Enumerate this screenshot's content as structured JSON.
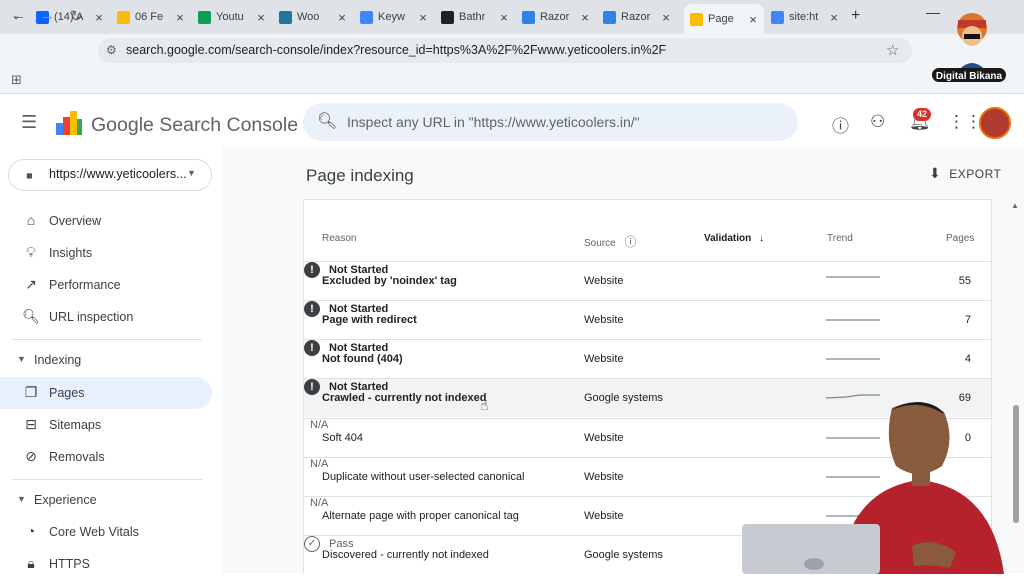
{
  "browser": {
    "tabs": [
      {
        "label": "(14) A",
        "icon": "meta-icon",
        "color": "#0866ff"
      },
      {
        "label": "06 Fe",
        "icon": "google-drive-icon",
        "color": "#fbbc04"
      },
      {
        "label": "Youtu",
        "icon": "google-sheets-icon",
        "color": "#0f9d58"
      },
      {
        "label": "Woo",
        "icon": "wordpress-icon",
        "color": "#21759b"
      },
      {
        "label": "Keyw",
        "icon": "semrush-icon",
        "color": "#4285f4"
      },
      {
        "label": "Bathr",
        "icon": "openai-icon",
        "color": "#202124"
      },
      {
        "label": "Razor",
        "icon": "razorpay-icon",
        "color": "#2b84ea"
      },
      {
        "label": "Razor",
        "icon": "razorpay-icon",
        "color": "#2b84ea"
      },
      {
        "label": "Page",
        "icon": "search-console-icon",
        "color": "#fbbc04",
        "active": true
      },
      {
        "label": "site:ht",
        "icon": "google-icon",
        "color": "#4285f4"
      }
    ],
    "url": "search.google.com/search-console/index?resource_id=https%3A%2F%2Fwww.yeticoolers.in%2F"
  },
  "watermark": {
    "text": "Digital Bikana"
  },
  "header": {
    "product": "Google Search Console",
    "search_placeholder": "Inspect any URL in \"https://www.yeticoolers.in/\"",
    "notification_count": "42"
  },
  "sidebar": {
    "property": "https://www.yeticoolers...",
    "items": [
      {
        "label": "Overview",
        "icon": "home-icon"
      },
      {
        "label": "Insights",
        "icon": "lightbulb-icon"
      },
      {
        "label": "Performance",
        "icon": "trending-up-icon"
      },
      {
        "label": "URL inspection",
        "icon": "search-icon"
      }
    ],
    "indexing": {
      "label": "Indexing",
      "items": [
        {
          "label": "Pages",
          "icon": "pages-icon",
          "active": true
        },
        {
          "label": "Sitemaps",
          "icon": "sitemap-icon"
        },
        {
          "label": "Removals",
          "icon": "eye-off-icon"
        }
      ]
    },
    "experience": {
      "label": "Experience",
      "items": [
        {
          "label": "Core Web Vitals",
          "icon": "gauge-icon"
        },
        {
          "label": "HTTPS",
          "icon": "lock-icon"
        }
      ]
    }
  },
  "main": {
    "title": "Page indexing",
    "export_label": "EXPORT",
    "table": {
      "headers": {
        "reason": "Reason",
        "source": "Source",
        "validation": "Validation",
        "trend": "Trend",
        "pages": "Pages"
      },
      "rows": [
        {
          "reason": "Excluded by 'noindex' tag",
          "source": "Website",
          "validation": "Not Started",
          "status": "not-started",
          "pages": "55",
          "bold": true
        },
        {
          "reason": "Page with redirect",
          "source": "Website",
          "validation": "Not Started",
          "status": "not-started",
          "pages": "7",
          "bold": true
        },
        {
          "reason": "Not found (404)",
          "source": "Website",
          "validation": "Not Started",
          "status": "not-started",
          "pages": "4",
          "bold": true
        },
        {
          "reason": "Crawled - currently not indexed",
          "source": "Google systems",
          "validation": "Not Started",
          "status": "not-started",
          "pages": "69",
          "bold": true,
          "hover": true
        },
        {
          "reason": "Soft 404",
          "source": "Website",
          "validation": "N/A",
          "status": "na",
          "pages": "0"
        },
        {
          "reason": "Duplicate without user-selected canonical",
          "source": "Website",
          "validation": "N/A",
          "status": "na",
          "pages": ""
        },
        {
          "reason": "Alternate page with proper canonical tag",
          "source": "Website",
          "validation": "N/A",
          "status": "na",
          "pages": ""
        },
        {
          "reason": "Discovered - currently not indexed",
          "source": "Google systems",
          "validation": "Pass",
          "status": "passed",
          "pages": ""
        }
      ]
    }
  }
}
